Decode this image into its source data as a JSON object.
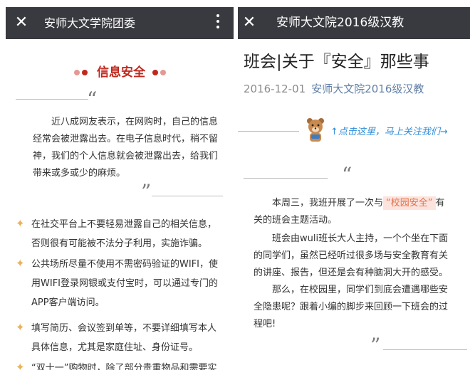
{
  "left": {
    "topbar": {
      "close_icon": "close-icon",
      "title": "安师大文学院团委",
      "more_icon": "more-vert-icon"
    },
    "heading": "信息安全",
    "colors": {
      "heading": "#c0281e",
      "dot_dark": "#c0281e",
      "dot_light": "#e39a94",
      "bullet_star": "#e8b25b"
    },
    "intro_lines": [
      "近八成网友表示，在网购时，自己的信息",
      "经常会被泄露出去。在电子信息时代，稍不留",
      "神，我们的个人信息就会被泄露出去，给我们",
      "带来或多或少的麻烦。"
    ],
    "bullets": [
      {
        "lines": [
          "在社交平台上不要轻易泄露自己的相关信息，",
          "否则很有可能被不法分子利用，实施诈骗。"
        ]
      },
      {
        "lines": [
          "公共场所尽量不使用不需密码验证的WIFI，使",
          "用WIFI登录网银或支付宝时，可以通过专门的",
          "APP客户端访问。"
        ]
      },
      {
        "lines": [
          "填写简历、会议签到单等，不要详细填写本人",
          "具体信息，尤其是家庭住址、身份证号。"
        ]
      },
      {
        "lines": [
          "“双十一”购物时，除了部分贵重物品和需要实"
        ]
      }
    ]
  },
  "right": {
    "topbar": {
      "close_icon": "close-icon",
      "title": "安师大文院2016级汉教"
    },
    "article_title": "班会|关于『安全』那些事",
    "date": "2016-12-01",
    "account": "安师大文院2016级汉教",
    "banner_text": "↑点击这里，马上关注我们→",
    "colors": {
      "account": "#607fa6",
      "banner": "#2f8dd8",
      "highlight_bg": "#fde3dd",
      "highlight_text": "#e0734b"
    },
    "para1": {
      "before": "本周三，我班开展了一次与",
      "highlight": "“校园安全”",
      "after": "有",
      "line2": "关的班会主题活动。"
    },
    "para2_lines": [
      "班会由wuli班长大人主持，一个个坐在下面",
      "的同学们，虽然已经听过很多场与安全教育有关",
      "的讲座、报告，但还是会有种脑洞大开的感受。"
    ],
    "para3_lines": [
      "那么，在校园里，同学们到底会遭遇哪些安",
      "全隐患呢？跟着小编的脚步来回顾一下班会的过",
      "程吧!"
    ]
  }
}
